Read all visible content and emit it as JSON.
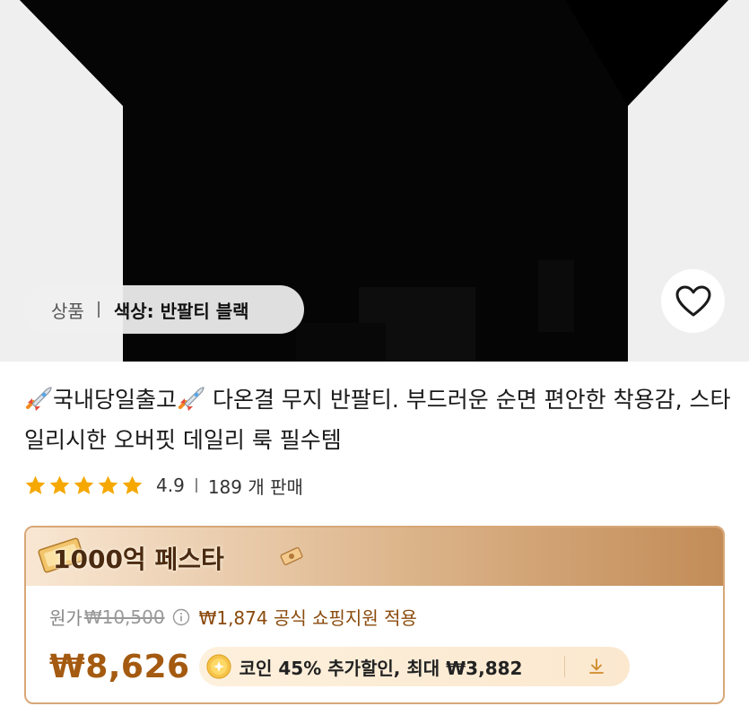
{
  "product_image": {
    "variant_label": "상품",
    "variant_value": "색상: 반팔티 블랙",
    "wishlist_icon": "heart-icon"
  },
  "title": {
    "badge_icon": "rocket-icon",
    "badge_text": "국내당일출고",
    "text": " 다온결 무지 반팔티. 부드러운 순면 편안한 착용감, 스타일리시한 오버핏 데일리 룩 필수템"
  },
  "rating": {
    "stars": 5,
    "score": "4.9",
    "sold": "189 개 판매",
    "star_color": "#f5a800"
  },
  "promo": {
    "banner_title": "1000억 페스타",
    "original_label": "원가",
    "original_price": "₩10,500",
    "support_text": "₩1,874 공식 쇼핑지원 적용",
    "final_price": "₩8,626",
    "coin_text": "코인 45% 추가할인, 최대 ₩3,882",
    "accent_color": "#a45a10"
  }
}
